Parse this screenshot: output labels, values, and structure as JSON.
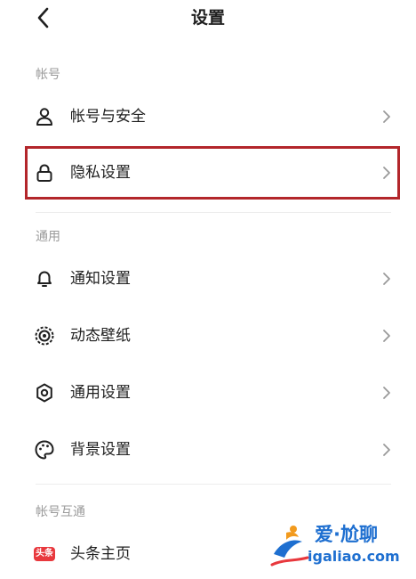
{
  "header": {
    "title": "设置"
  },
  "sections": [
    {
      "label": "帐号"
    },
    {
      "label": "通用"
    },
    {
      "label": "帐号互通"
    }
  ],
  "items": {
    "account_security": {
      "label": "帐号与安全",
      "icon": "user-icon"
    },
    "privacy": {
      "label": "隐私设置",
      "icon": "lock-icon"
    },
    "notification": {
      "label": "通知设置",
      "icon": "bell-icon"
    },
    "wallpaper": {
      "label": "动态壁纸",
      "icon": "wallpaper-icon"
    },
    "general": {
      "label": "通用设置",
      "icon": "gear-icon"
    },
    "background": {
      "label": "背景设置",
      "icon": "palette-icon"
    },
    "toutiao": {
      "label": "头条主页",
      "badge": "头条"
    }
  },
  "colors": {
    "highlight": "#b3262b",
    "badge": "#e8383d",
    "watermark": "#1e6fd0"
  },
  "watermark": {
    "title": "爱·尬聊",
    "url": "igaliao.com"
  }
}
